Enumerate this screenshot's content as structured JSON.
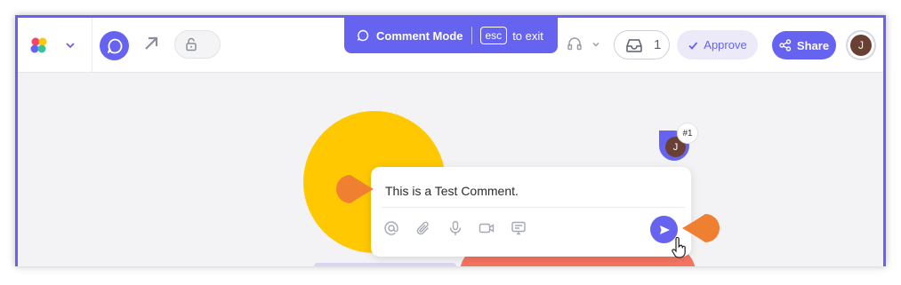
{
  "colors": {
    "accent": "#6563f0",
    "callout": "#ef7f31",
    "yellow": "#ffc800",
    "coral": "#f47462"
  },
  "topbar": {
    "logo_icon": "app-logo-icon",
    "mode_banner": {
      "label": "Comment Mode",
      "key": "esc",
      "exit_text": "to exit"
    },
    "inbox_count": "1",
    "approve_label": "Approve",
    "share_label": "Share",
    "avatar_initial": "J"
  },
  "canvas": {
    "marker": {
      "initial": "J",
      "badge": "#1"
    },
    "comment": {
      "text": "This is a Test Comment.",
      "tools": [
        "mention-icon",
        "attach-icon",
        "microphone-icon",
        "video-icon",
        "screen-icon"
      ]
    }
  }
}
